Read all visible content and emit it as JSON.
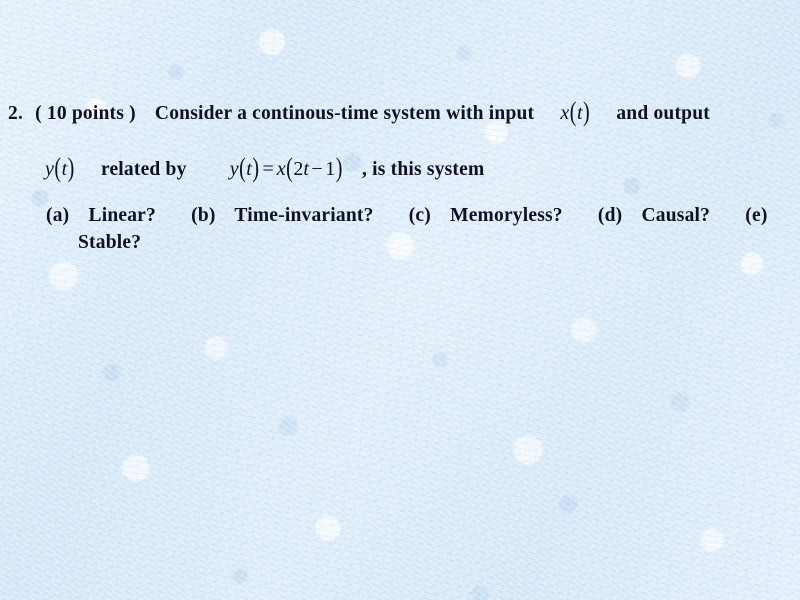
{
  "slide": {
    "background_color": "#dcebf9",
    "text_color": "#101023",
    "question_number": "2.",
    "points_label": "( 10 points )",
    "prompt_before_input": "Consider a continous-time system with input",
    "prompt_after_input": "and output",
    "input_signal": {
      "var": "x",
      "open": "(",
      "arg": "t",
      "close": ")"
    },
    "output_signal": {
      "var": "y",
      "open": "(",
      "arg": "t",
      "close": ")"
    },
    "related_by_label": "related by",
    "equation": {
      "lhs_var": "y",
      "lhs_open": "(",
      "lhs_arg": "t",
      "lhs_close": ")",
      "equals": "=",
      "rhs_var": "x",
      "rhs_open": "(",
      "rhs_coeff": "2",
      "rhs_arg": "t",
      "rhs_minus": "−",
      "rhs_const": "1",
      "rhs_close": ")",
      "plain": "y(t) = x(2t − 1)"
    },
    "trailing_question": ", is this system",
    "parts": [
      {
        "label": "(a)",
        "text": "Linear?"
      },
      {
        "label": "(b)",
        "text": "Time-invariant?"
      },
      {
        "label": "(c)",
        "text": "Memoryless?"
      },
      {
        "label": "(d)",
        "text": "Causal?"
      },
      {
        "label": "(e)",
        "text": "Stable?"
      }
    ]
  }
}
